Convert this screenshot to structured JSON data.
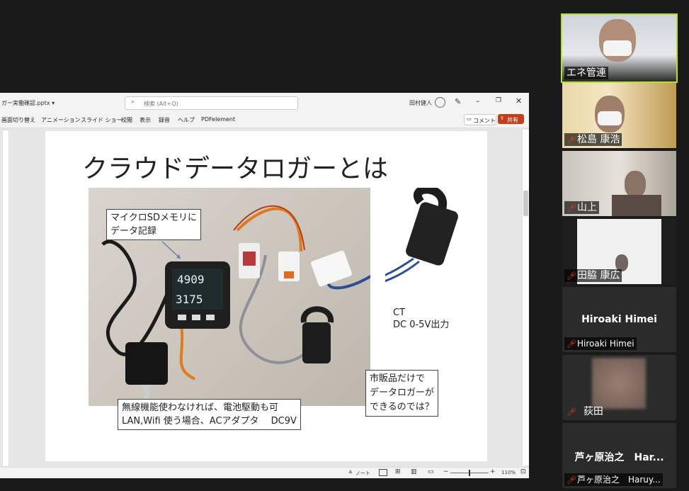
{
  "ppt": {
    "filename": "ガー実働確認.pptx ▾",
    "search_placeholder": "検索 (Alt+Q)",
    "user": "田村健人",
    "ribbon_tabs": [
      "画面切り替え",
      "アニメーション",
      "スライド ショー",
      "校閲",
      "表示",
      "録音",
      "ヘルプ",
      "PDFelement"
    ],
    "comment_label": "コメント",
    "share_label": "共有",
    "notes_label": "ノート",
    "zoom": "110%"
  },
  "slide": {
    "title": "クラウドデータロガーとは",
    "box1_line1": "マイクロSDメモリに",
    "box1_line2": "データ記録",
    "ct_line1": "CT",
    "ct_line2": "DC 0-5V出力",
    "box2_line1": "市販品だけで",
    "box2_line2": "データロガーが",
    "box2_line3": "できるのでは？",
    "box3_line1": "無線機能使わなければ、電池駆動も可",
    "box3_line2": "LAN,Wifi 使う場合、ACアダプタ　 DC9V",
    "display_line1": "4909",
    "display_line2": "3175"
  },
  "participants": [
    {
      "name": "エネ管連"
    },
    {
      "name": "松島 康浩"
    },
    {
      "name": "山上"
    },
    {
      "name": "田脇 康広"
    },
    {
      "name": "Hiroaki Himei",
      "display": "Hiroaki Himei"
    },
    {
      "name": "荻田"
    },
    {
      "name": "芦ヶ原治之　Haruy...",
      "display": "芦ヶ原治之　Har..."
    }
  ]
}
